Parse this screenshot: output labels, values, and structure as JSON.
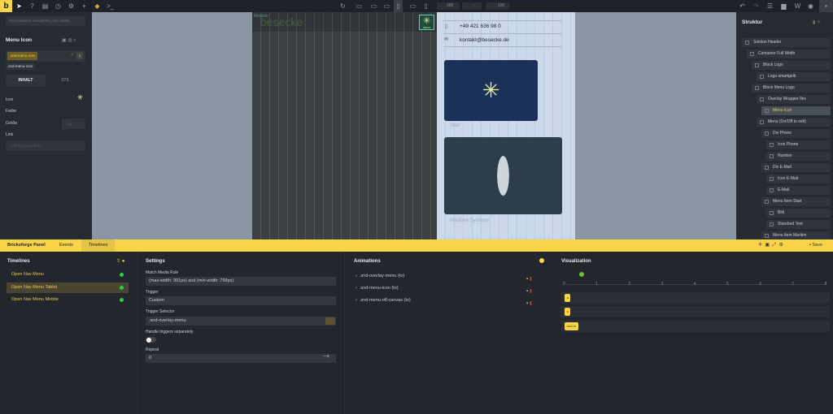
{
  "topbar": {
    "logo": "b",
    "width_value": "990",
    "height_value": "-",
    "zoom_value": "100"
  },
  "left_panel": {
    "pseudo_placeholder": "Pseudoklasse auswählen oder erstell...",
    "element_title": "Menu Icon",
    "class_chip": ".snd-menu-icon",
    "class_count": "1",
    "class_tag": ".snd-menu-icon",
    "tabs": [
      "INHALT",
      "STIL"
    ],
    "fields": {
      "icon": "Icon",
      "farbe": "Farbe",
      "groesse": "Größe",
      "groesse_placeholder": "Ypx",
      "link": "Link",
      "link_placeholder": "Link-Typ auswählen"
    }
  },
  "preview": {
    "breakpoint": "Medium",
    "brand": "besecke",
    "phone": "+49 421 636 98 0",
    "email": "kontakt@besecke.de",
    "item1": "Start",
    "item2": "Maritime Systeme",
    "menu_icon_label": "MENU"
  },
  "structure": {
    "title": "Struktur",
    "nodes": [
      "Sektion Header",
      "Container Full Width",
      "Block Logo",
      "Logo smartgelb",
      "Block Menu Logo",
      "Overlay Wrapper flex",
      "Menu Icon",
      "Menu (On/Off to edit)",
      "Div Phone",
      "Icon Phone",
      "Number",
      "Div E-Mail",
      "Icon E-Mail",
      "E-Mail",
      "Menu Item Start",
      "Bild",
      "Standard Text",
      "Menu Item Maritim"
    ]
  },
  "bottom": {
    "tabs": [
      "Bricksforge Panel",
      "Events",
      "Timelines"
    ],
    "save": "Save",
    "timelines": {
      "title": "Timelines",
      "items": [
        "Open Nav Menu",
        "Open Nav Menu Tablet",
        "Open Nav Menu Mobile"
      ]
    },
    "settings": {
      "title": "Settings",
      "match_label": "Match Media Rule",
      "match_value": "(max-width: 991px) and (min-width: 768px)",
      "trigger_label": "Trigger",
      "trigger_value": "Custom",
      "selector_label": "Trigger Selector",
      "selector_value": ".snd-overlay-menu",
      "handle_label": "Handle triggers separately",
      "repeat_label": "Repeat",
      "repeat_value": "0"
    },
    "animations": {
      "title": "Animations",
      "items": [
        ".snd-overlay-menu (to)",
        ".snd-menu-icon (to)",
        ".snd-menu-off-canvas (to)"
      ]
    },
    "visualization": {
      "title": "Visualization",
      "ticks": [
        "0",
        "1",
        "2",
        "3",
        "4",
        "5",
        "6",
        "7",
        "8"
      ],
      "bars": [
        ".s",
        ".s",
        ".snd-m"
      ]
    }
  },
  "colors": {
    "accent": "#f8d548",
    "active": "#2fd13a"
  }
}
